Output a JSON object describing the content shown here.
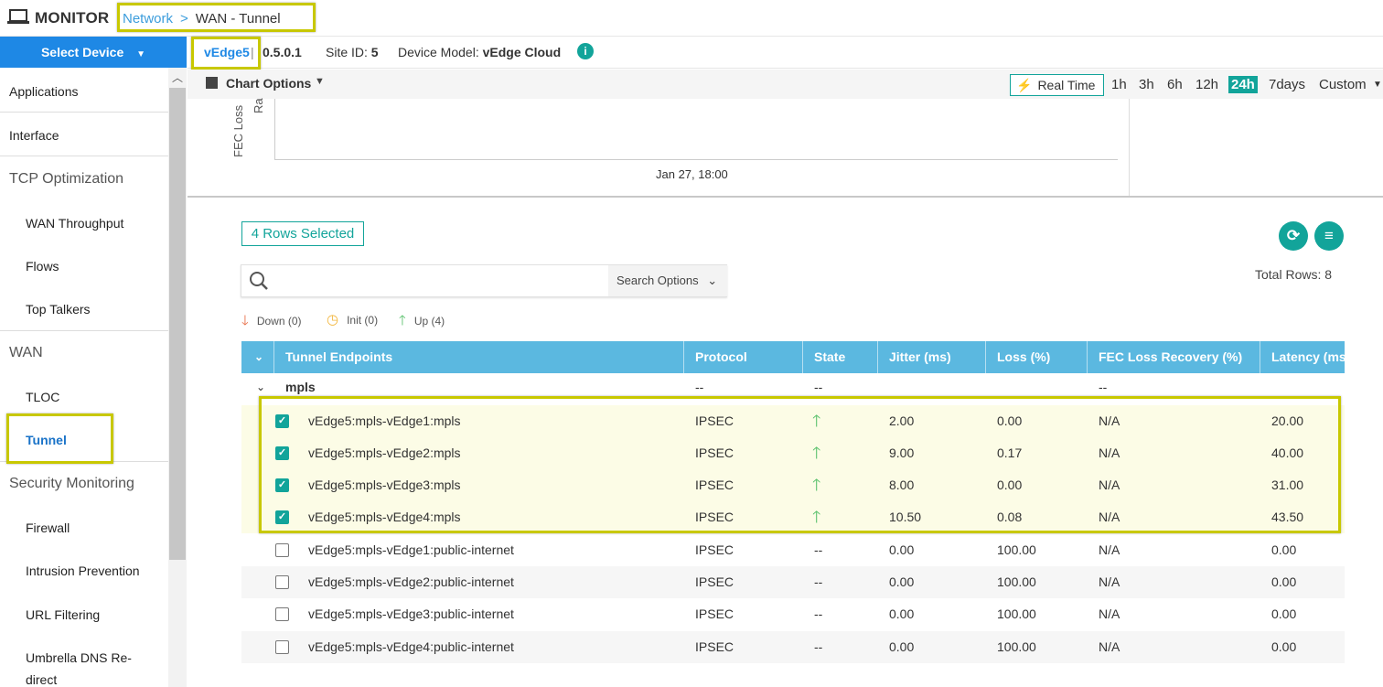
{
  "header": {
    "app_title": "MONITOR",
    "breadcrumb_link": "Network",
    "breadcrumb_sep": ">",
    "breadcrumb_current": "WAN - Tunnel"
  },
  "sidebar": {
    "select_device": "Select Device",
    "items": [
      {
        "label": "Applications"
      },
      {
        "label": "Interface"
      },
      {
        "label": "TCP Optimization"
      },
      {
        "label": "WAN Throughput"
      },
      {
        "label": "Flows"
      },
      {
        "label": "Top Talkers"
      },
      {
        "label": "WAN"
      },
      {
        "label": "TLOC"
      },
      {
        "label": "Tunnel"
      },
      {
        "label": "Security Monitoring"
      },
      {
        "label": "Firewall"
      },
      {
        "label": "Intrusion Prevention"
      },
      {
        "label": "URL Filtering"
      },
      {
        "label": "Umbrella DNS Re-"
      },
      {
        "label": "direct"
      }
    ]
  },
  "device": {
    "name": "vEdge5",
    "pipe": "|",
    "ip": "0.5.0.1",
    "site_label": "Site ID:",
    "site_value": "5",
    "model_label": "Device Model:",
    "model_value": "vEdge Cloud",
    "info_glyph": "i"
  },
  "chart_bar": {
    "options_label": "Chart Options",
    "realtime_label": "Real Time",
    "ranges": [
      "1h",
      "3h",
      "6h",
      "12h",
      "24h",
      "7days",
      "Custom"
    ],
    "active_range": "24h",
    "accent_color": "#12a49a"
  },
  "chart": {
    "ylabel": "FEC Loss",
    "ylabel2": "Ra",
    "xtick": "Jan 27, 18:00"
  },
  "table_controls": {
    "rows_selected": "4 Rows Selected",
    "total_rows": "Total Rows: 8",
    "search_placeholder": "",
    "search_options": "Search Options",
    "legend": {
      "down": "Down (0)",
      "init": "Init (0)",
      "up": "Up (4)"
    }
  },
  "table": {
    "columns": [
      "Tunnel Endpoints",
      "Protocol",
      "State",
      "Jitter (ms)",
      "Loss (%)",
      "FEC Loss Recovery (%)",
      "Latency (ms"
    ],
    "group": {
      "name": "mpls",
      "protocol": "--",
      "state": "--",
      "fec": "--"
    },
    "rows": [
      {
        "endpoint": "vEdge5:mpls-vEdge1:mpls",
        "protocol": "IPSEC",
        "state": "up",
        "jitter": "2.00",
        "loss": "0.00",
        "fec": "N/A",
        "latency": "20.00",
        "selected": true
      },
      {
        "endpoint": "vEdge5:mpls-vEdge2:mpls",
        "protocol": "IPSEC",
        "state": "up",
        "jitter": "9.00",
        "loss": "0.17",
        "fec": "N/A",
        "latency": "40.00",
        "selected": true
      },
      {
        "endpoint": "vEdge5:mpls-vEdge3:mpls",
        "protocol": "IPSEC",
        "state": "up",
        "jitter": "8.00",
        "loss": "0.00",
        "fec": "N/A",
        "latency": "31.00",
        "selected": true
      },
      {
        "endpoint": "vEdge5:mpls-vEdge4:mpls",
        "protocol": "IPSEC",
        "state": "up",
        "jitter": "10.50",
        "loss": "0.08",
        "fec": "N/A",
        "latency": "43.50",
        "selected": true
      },
      {
        "endpoint": "vEdge5:mpls-vEdge1:public-internet",
        "protocol": "IPSEC",
        "state": "--",
        "jitter": "0.00",
        "loss": "100.00",
        "fec": "N/A",
        "latency": "0.00",
        "selected": false
      },
      {
        "endpoint": "vEdge5:mpls-vEdge2:public-internet",
        "protocol": "IPSEC",
        "state": "--",
        "jitter": "0.00",
        "loss": "100.00",
        "fec": "N/A",
        "latency": "0.00",
        "selected": false
      },
      {
        "endpoint": "vEdge5:mpls-vEdge3:public-internet",
        "protocol": "IPSEC",
        "state": "--",
        "jitter": "0.00",
        "loss": "100.00",
        "fec": "N/A",
        "latency": "0.00",
        "selected": false
      },
      {
        "endpoint": "vEdge5:mpls-vEdge4:public-internet",
        "protocol": "IPSEC",
        "state": "--",
        "jitter": "0.00",
        "loss": "100.00",
        "fec": "N/A",
        "latency": "0.00",
        "selected": false
      }
    ]
  },
  "icons": {
    "monitor": "laptop-icon",
    "search": "search-icon",
    "refresh": "refresh-icon",
    "menu": "menu-icon",
    "down": "arrow-down-icon",
    "init": "clock-icon",
    "up": "arrow-up-icon"
  }
}
